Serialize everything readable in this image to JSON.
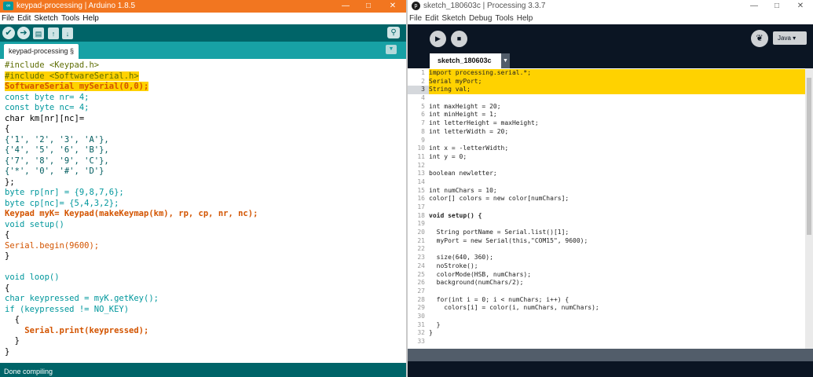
{
  "arduino": {
    "title": "keypad-processing | Arduino 1.8.5",
    "menu": [
      "File",
      "Edit",
      "Sketch",
      "Tools",
      "Help"
    ],
    "tab": "keypad-processing §",
    "status": "Done compiling",
    "code": [
      "#include <Keypad.h>",
      "#include <SoftwareSerial.h>",
      "SoftwareSerial mySerial(0,0);",
      "const byte nr= 4;",
      "const byte nc= 4;",
      "char km[nr][nc]=",
      "{",
      "{'1', '2', '3', 'A'},",
      "{'4', '5', '6', 'B'},",
      "{'7', '8', '9', 'C'},",
      "{'*', '0', '#', 'D'}",
      "};",
      "byte rp[nr] = {9,8,7,6};",
      "byte cp[nc]= {5,4,3,2};",
      "Keypad myK= Keypad(makeKeymap(km), rp, cp, nr, nc);",
      "void setup()",
      "{",
      "Serial.begin(9600);",
      "}",
      "",
      "void loop()",
      "{",
      "char keypressed = myK.getKey();",
      "if (keypressed != NO_KEY)",
      "  {",
      "    Serial.print(keypressed);",
      "  }",
      "}"
    ]
  },
  "processing": {
    "title": "sketch_180603c | Processing 3.3.7",
    "menu": [
      "File",
      "Edit",
      "Sketch",
      "Debug",
      "Tools",
      "Help"
    ],
    "tab": "sketch_180603c",
    "mode": "Java ▾",
    "code": [
      "import processing.serial.*;",
      "Serial myPort;",
      "String val;",
      "",
      "int maxHeight = 20;",
      "int minHeight = 1;",
      "int letterHeight = maxHeight;",
      "int letterWidth = 20;",
      "",
      "int x = -letterWidth;",
      "int y = 0;",
      "",
      "boolean newletter;",
      "",
      "int numChars = 10;",
      "color[] colors = new color[numChars];",
      "",
      "void setup() {",
      "",
      "  String portName = Serial.list()[1];",
      "  myPort = new Serial(this,\"COM15\", 9600);",
      "",
      "  size(640, 360);",
      "  noStroke();",
      "  colorMode(HSB, numChars);",
      "  background(numChars/2);",
      "",
      "  for(int i = 0; i < numChars; i++) {",
      "    colors[i] = color(i, numChars, numChars);",
      "",
      "  }",
      "}",
      ""
    ]
  },
  "colors": {
    "arduino_title": "#f27620",
    "arduino_teal_dark": "#006468",
    "arduino_teal": "#17a1a5",
    "highlight": "#ffd200",
    "processing_bg": "#0b1523"
  }
}
